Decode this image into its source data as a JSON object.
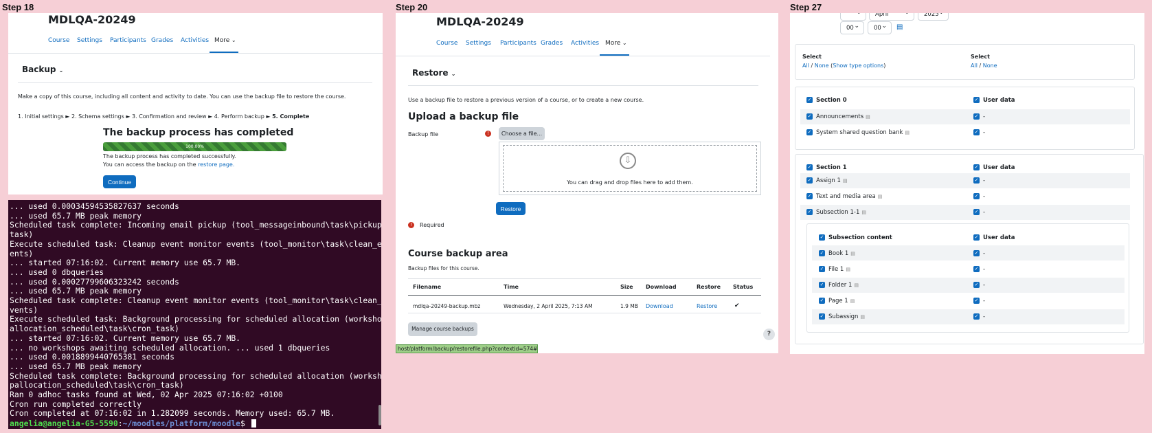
{
  "steps": {
    "step18": "Step 18",
    "step20": "Step 20",
    "step27": "Step 27"
  },
  "panel1": {
    "course_title": "MDLQA-20249",
    "nav": [
      "Course",
      "Settings",
      "Participants",
      "Grades",
      "Activities",
      "More"
    ],
    "page_heading": "Backup",
    "description": "Make a copy of this course, including all content and activity to date. You can use the backup file to restore the course.",
    "steps_crumbs": "1. Initial settings ► 2. Schema settings ► 3. Confirmation and review ► 4. Perform backup ► ",
    "steps_current": "5. Complete",
    "completed_heading": "The backup process has completed",
    "progress": {
      "percent": 100,
      "label": "100.00%"
    },
    "success_msg": "The backup process has completed successfully.",
    "access_msg": "You can access the backup on the ",
    "restore_link": "restore page.",
    "continue_button": "Continue"
  },
  "terminal": {
    "lines": [
      "... used 0.00034594535827637 seconds",
      "... used 65.7 MB peak memory",
      "Scheduled task complete: Incoming email pickup (tool_messageinbound\\task\\pickup_",
      "task)",
      "Execute scheduled task: Cleanup event monitor events (tool_monitor\\task\\clean_ev",
      "ents)",
      "... started 07:16:02. Current memory use 65.7 MB.",
      "... used 0 dbqueries",
      "... used 0.00027799606323242 seconds",
      "... used 65.7 MB peak memory",
      "Scheduled task complete: Cleanup event monitor events (tool_monitor\\task\\clean_e",
      "vents)",
      "Execute scheduled task: Background processing for scheduled allocation (workshop",
      "allocation_scheduled\\task\\cron_task)",
      "... started 07:16:02. Current memory use 65.7 MB.",
      "... no workshops awaiting scheduled allocation. ... used 1 dbqueries",
      "... used 0.0018899440765381 seconds",
      "... used 65.7 MB peak memory",
      "Scheduled task complete: Background processing for scheduled allocation (worksho",
      "pallocation_scheduled\\task\\cron_task)",
      "Ran 0 adhoc tasks found at Wed, 02 Apr 2025 07:16:02 +0100",
      "Cron run completed correctly",
      "Cron completed at 07:16:02 in 1.282099 seconds. Memory used: 65.7 MB."
    ],
    "prompt_user": "angelia@angelia-G5-5590",
    "prompt_sep": ":",
    "prompt_path": "~/moodles/platform/moodle",
    "prompt_end": "$ "
  },
  "panel2": {
    "course_title": "MDLQA-20249",
    "nav": [
      "Course",
      "Settings",
      "Participants",
      "Grades",
      "Activities",
      "More"
    ],
    "page_heading": "Restore",
    "description": "Use a backup file to restore a previous version of a course, or to create a new course.",
    "upload_heading": "Upload a backup file",
    "backup_file_label": "Backup file",
    "choose_file_button": "Choose a file...",
    "drop_text": "You can drag and drop files here to add them.",
    "restore_button": "Restore",
    "required_text": "Required",
    "area_heading": "Course backup area",
    "area_desc": "Backup files for this course.",
    "table": {
      "headers": [
        "Filename",
        "Time",
        "Size",
        "Download",
        "Restore",
        "Status"
      ],
      "row": [
        "mdlqa-20249-backup.mbz",
        "Wednesday, 2 April 2025, 7:13 AM",
        "1.9 MB",
        "Download",
        "Restore",
        "✔"
      ]
    },
    "manage_button": "Manage course backups",
    "help_button": "?",
    "status_url": "host/platform/backup/restorefile.php?contextid=574#"
  },
  "panel3": {
    "date": {
      "month": "April",
      "year": "2025",
      "hour": "00",
      "minute": "00"
    },
    "select1": {
      "label": "Select",
      "all": "All",
      "sep": " / ",
      "none": "None",
      "open": " (",
      "show": "Show type options",
      "close": ")"
    },
    "select2": {
      "label": "Select",
      "all": "All",
      "sep": " / ",
      "none": "None"
    },
    "section0": {
      "title": "Section 0",
      "userdata": "User data",
      "items": [
        {
          "name": "Announcements",
          "val": "-"
        },
        {
          "name": "System shared question bank",
          "val": "-"
        }
      ]
    },
    "section1": {
      "title": "Section 1",
      "userdata": "User data",
      "items": [
        {
          "name": "Assign 1",
          "val": "-"
        },
        {
          "name": "Text and media area",
          "val": "-"
        },
        {
          "name": "Subsection 1-1",
          "val": "-"
        }
      ]
    },
    "subsection": {
      "title": "Subsection content",
      "userdata": "User data",
      "items": [
        {
          "name": "Book 1",
          "val": "-"
        },
        {
          "name": "File 1",
          "val": "-"
        },
        {
          "name": "Folder 1",
          "val": "-"
        },
        {
          "name": "Page 1",
          "val": "-"
        },
        {
          "name": "Subassign",
          "val": "-"
        }
      ]
    }
  }
}
